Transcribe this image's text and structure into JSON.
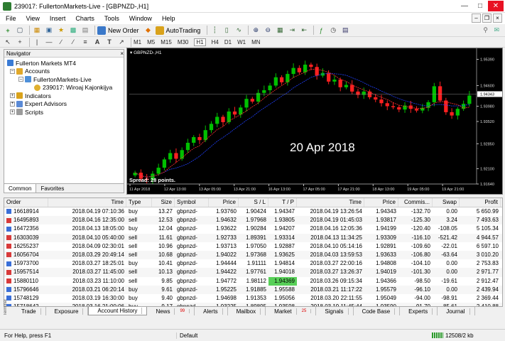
{
  "window": {
    "title": "239017: FullertonMarkets-Live - [GBPNZD-,H1]"
  },
  "menu": [
    "File",
    "View",
    "Insert",
    "Charts",
    "Tools",
    "Window",
    "Help"
  ],
  "toolbar": {
    "new_order": "New Order",
    "autotrading": "AutoTrading"
  },
  "timeframes": [
    "M1",
    "M5",
    "M15",
    "M30",
    "H1",
    "H4",
    "D1",
    "W1",
    "MN"
  ],
  "navigator": {
    "title": "Navigator",
    "items": [
      "Fullerton Markets MT4",
      "Accounts",
      "FullertonMarkets-Live",
      "239017: Wiroaj Kajonkijya",
      "Indicators",
      "Expert Advisors",
      "Scripts"
    ],
    "tabs": [
      "Common",
      "Favorites"
    ]
  },
  "chart": {
    "symbol": "GBPNZD-,H1",
    "annotation": "20 Apr 2018",
    "spread": "Spread: 28 points.",
    "price_label": "1.94343"
  },
  "chart_data": {
    "type": "candlestick",
    "title": "GBPNZD-,H1",
    "y_ticks": [
      "1.95390",
      "1.94600",
      "1.93980",
      "1.93520",
      "1.92850",
      "1.92100",
      "1.91640"
    ],
    "x_ticks": [
      "11 Apr 2018",
      "12 Apr 13:00",
      "13 Apr 05:00",
      "13 Apr 21:00",
      "16 Apr 13:00",
      "17 Apr 05:00",
      "17 Apr 21:00",
      "18 Apr 13:00",
      "19 Apr 05:00",
      "19 Apr 21:00"
    ],
    "ylim": [
      1.9164,
      1.9555
    ],
    "close": [
      1.9198,
      1.918,
      1.9176,
      1.9195,
      1.9213,
      1.9238,
      1.9257,
      1.924,
      1.9266,
      1.9288,
      1.9305,
      1.9296,
      1.9326,
      1.9345,
      1.9366,
      1.935,
      1.9382,
      1.9373,
      1.9394,
      1.942,
      1.9412,
      1.9438,
      1.9446,
      1.946,
      1.9485,
      1.947,
      1.9495,
      1.9513,
      1.95,
      1.9523,
      1.9516,
      1.949,
      1.9498,
      1.9472,
      1.9478,
      1.9455,
      1.9462,
      1.9442,
      1.9432,
      1.9442,
      1.9425,
      1.9418,
      1.9407,
      1.9398,
      1.9395,
      1.9388,
      1.94,
      1.939,
      1.9385,
      1.9393,
      1.941,
      1.9458,
      1.9415,
      1.938,
      1.937,
      1.939,
      1.9405,
      1.943
    ]
  },
  "terminal": {
    "side_label": "Terminal",
    "columns": [
      "Order",
      "Time",
      "Type",
      "Size",
      "Symbol",
      "Price",
      "S / L",
      "T / P",
      "Time",
      "Price",
      "Commis...",
      "Swap",
      "Profit"
    ],
    "rows": [
      [
        "16618914",
        "2018.04.19 07:10:36",
        "buy",
        "13.27",
        "gbpnzd-",
        "1.93760",
        "1.90424",
        "1.94347",
        "2018.04.19 13:26:54",
        "1.94343",
        "-132.70",
        "0.00",
        "5 650.99"
      ],
      [
        "16495893",
        "2018.04.16 12:35:00",
        "sell",
        "12.53",
        "gbpnzd-",
        "1.94632",
        "1.97968",
        "1.93805",
        "2018.04.19 01:45:03",
        "1.93817",
        "-125.30",
        "3.24",
        "7 493.63"
      ],
      [
        "16472356",
        "2018.04.13 18:05:00",
        "buy",
        "12.04",
        "gbpnzd-",
        "1.93622",
        "1.90284",
        "1.94207",
        "2018.04.16 12:05:36",
        "1.94199",
        "-120.40",
        "-108.05",
        "5 105.34"
      ],
      [
        "16303039",
        "2018.04.10 05:40:00",
        "sell",
        "11.61",
        "gbpnzd-",
        "1.92733",
        "1.89391",
        "1.93314",
        "2018.04.13 11:34:25",
        "1.93309",
        "-116.10",
        "-521.42",
        "4 944.57"
      ],
      [
        "16255237",
        "2018.04.09 02:30:01",
        "sell",
        "10.96",
        "gbpnzd-",
        "1.93713",
        "1.97050",
        "1.92887",
        "2018.04.10 05:14:16",
        "1.92891",
        "-109.60",
        "-22.01",
        "6 597.10"
      ],
      [
        "16056704",
        "2018.03.29 20:49:14",
        "sell",
        "10.68",
        "gbpnzd-",
        "1.94022",
        "1.97368",
        "1.93625",
        "2018.04.03 13:59:53",
        "1.93633",
        "-106.80",
        "-63.64",
        "3 010.20"
      ],
      [
        "15973700",
        "2018.03.27 18:25:01",
        "buy",
        "10.41",
        "gbpnzd-",
        "1.94444",
        "1.91111",
        "1.94814",
        "2018.03.27 22:00:16",
        "1.94808",
        "-104.10",
        "0.00",
        "2 753.83"
      ],
      [
        "15957514",
        "2018.03.27 11:45:00",
        "sell",
        "10.13",
        "gbpnzd-",
        "1.94422",
        "1.97761",
        "1.94018",
        "2018.03.27 13:26:37",
        "1.94019",
        "-101.30",
        "0.00",
        "2 971.77"
      ],
      [
        "15880110",
        "2018.03.23 11:10:00",
        "sell",
        "9.85",
        "gbpnzd-",
        "1.94772",
        "1.98112",
        "1.94369",
        "2018.03.26 09:15:34",
        "1.94366",
        "-98.50",
        "-19.61",
        "2 912.47"
      ],
      [
        "15796646",
        "2018.03.21 06:20:14",
        "buy",
        "9.61",
        "gbpnzd-",
        "1.95225",
        "1.91885",
        "1.95588",
        "2018.03.21 11:17:22",
        "1.95579",
        "-96.10",
        "0.00",
        "2 439.94"
      ],
      [
        "15748129",
        "2018.03.19 16:30:00",
        "buy",
        "9.40",
        "gbpnzd-",
        "1.94698",
        "1.91353",
        "1.95056",
        "2018.03.20 22:11:55",
        "1.95049",
        "-94.00",
        "-98.91",
        "2 369.44"
      ],
      [
        "15718642",
        "2018.03.16 21:00:06",
        "buy",
        "9.17",
        "gbpnzd-",
        "1.93225",
        "1.89895",
        "1.93598",
        "2018.03.19 11:45:44",
        "1.93590",
        "-91.70",
        "-85.61",
        "2 410.88"
      ]
    ],
    "tabs": [
      "Trade",
      "Exposure",
      "Account History",
      "News",
      "Alerts",
      "Mailbox",
      "Market",
      "Signals",
      "Code Base",
      "Experts",
      "Journal"
    ],
    "badges": {
      "news": "99",
      "market": "25"
    },
    "active_tab": "Account History"
  },
  "status": {
    "help": "For Help, press F1",
    "profile": "Default",
    "traffic": "12508/2 kb"
  },
  "colors": {
    "bull": "#00c000",
    "bear": "#ff2020",
    "highlight": "#58d058"
  }
}
